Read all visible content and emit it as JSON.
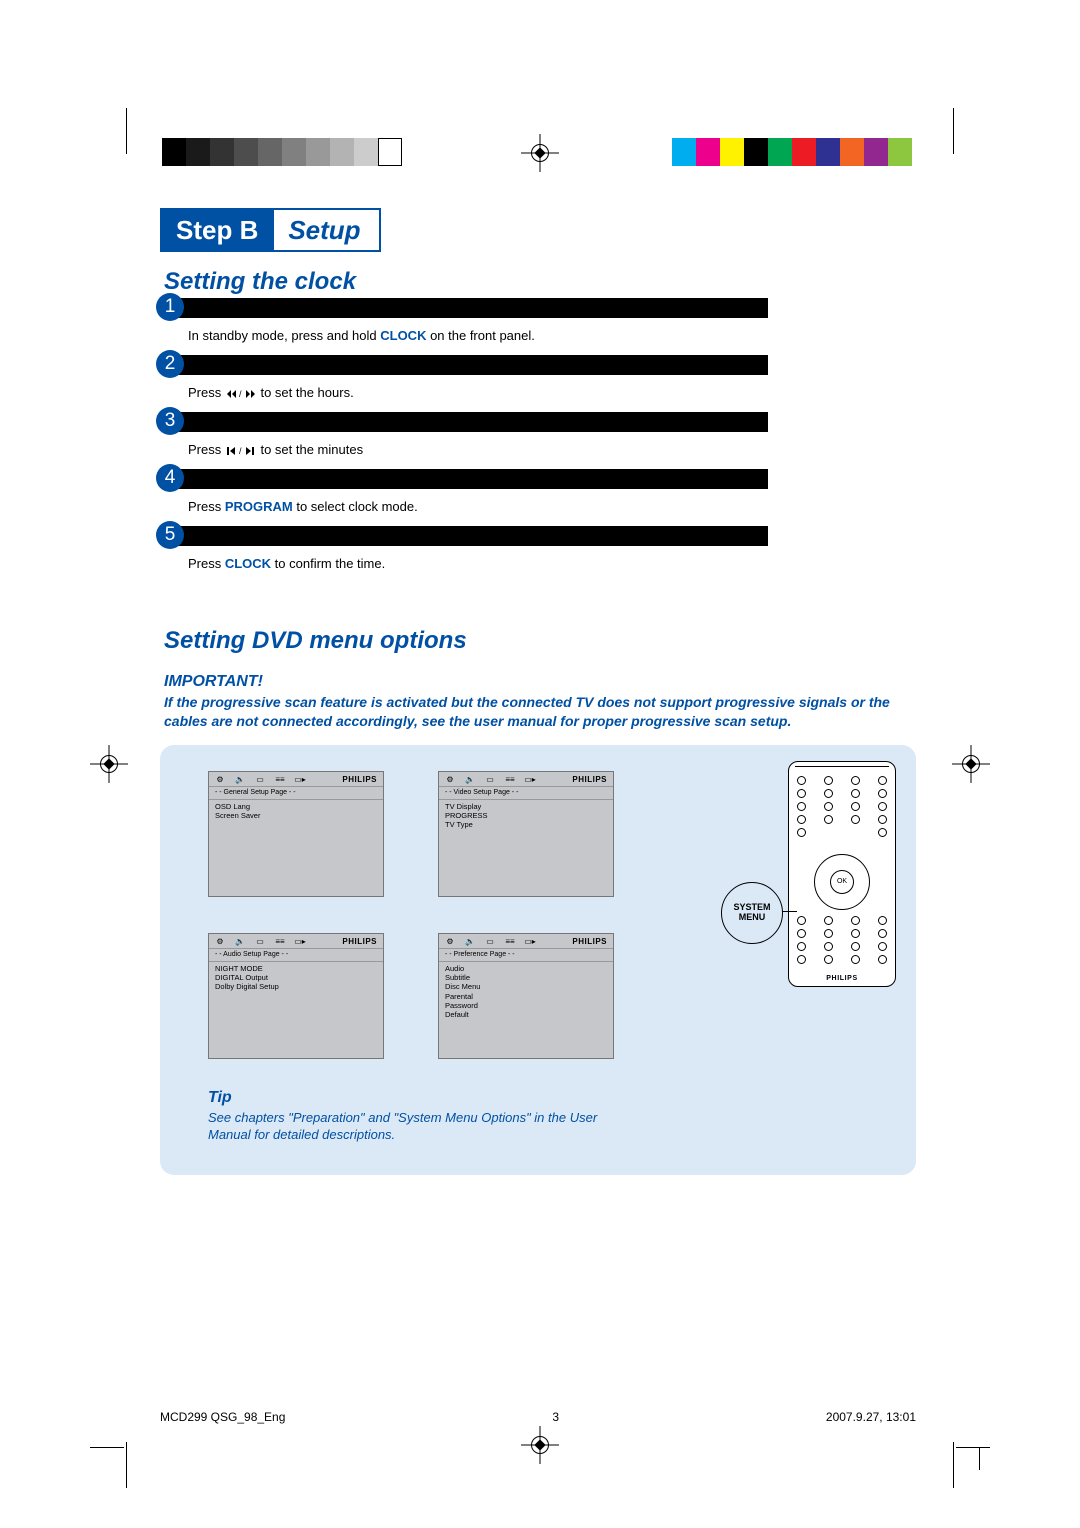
{
  "header": {
    "step_label": "Step B",
    "setup_label": "Setup"
  },
  "clock_section": {
    "title": "Setting the clock",
    "steps": [
      {
        "n": "1",
        "pre": "In standby mode, press and hold ",
        "kw": "CLOCK",
        "post": " on the front panel."
      },
      {
        "n": "2",
        "pre": "Press ",
        "glyph": "rew-ffwd",
        "post": " to set the hours."
      },
      {
        "n": "3",
        "pre": "Press  ",
        "glyph": "prev-next",
        "post": " to set the minutes"
      },
      {
        "n": "4",
        "pre": "Press ",
        "kw": "PROGRAM",
        "post": " to select clock mode."
      },
      {
        "n": "5",
        "pre": "Press ",
        "kw": "CLOCK",
        "post": " to confirm the time."
      }
    ]
  },
  "dvd_section": {
    "title": "Setting DVD menu options",
    "important_label": "IMPORTANT!",
    "important_body": "If the progressive scan feature is activated but the connected TV does not support progressive signals or the cables are not connected accordingly, see the user manual for proper progressive scan setup.",
    "screens": [
      {
        "tab": "- -   General Setup Page   - -",
        "items": [
          "OSD Lang",
          "Screen Saver"
        ]
      },
      {
        "tab": "- -   Video Setup Page   - -",
        "items": [
          "TV Display",
          "PROGRESS",
          "TV Type"
        ]
      },
      {
        "tab": "- -   Audio Setup Page   - -",
        "items": [
          "NIGHT MODE",
          "DIGITAL Output",
          "Dolby Digital Setup"
        ]
      },
      {
        "tab": "- -   Preference Page   - -",
        "items": [
          "Audio",
          "Subtitle",
          "Disc Menu",
          "Parental",
          "Password",
          "Default"
        ]
      }
    ],
    "screen_brand": "PHILIPS",
    "tip_label": "Tip",
    "tip_body": "See chapters \"Preparation\" and \"System Menu Options\" in the User Manual for detailed descriptions."
  },
  "remote": {
    "callout_l1": "SYSTEM",
    "callout_l2": "MENU",
    "brand": "PHILIPS",
    "ok": "OK"
  },
  "footer": {
    "doc": "MCD299 QSG_98_Eng",
    "page": "3",
    "date": "2007.9.27, 13:01"
  },
  "swatches": {
    "left": [
      "#000000",
      "#1a1a1a",
      "#333333",
      "#4d4d4d",
      "#666666",
      "#808080",
      "#999999",
      "#b3b3b3",
      "#cccccc",
      "#ffffff"
    ],
    "right": [
      "#00aeef",
      "#ec008c",
      "#fff200",
      "#000000",
      "#00a651",
      "#ed1c24",
      "#2e3192",
      "#f26522",
      "#92278f",
      "#8dc63f"
    ]
  }
}
